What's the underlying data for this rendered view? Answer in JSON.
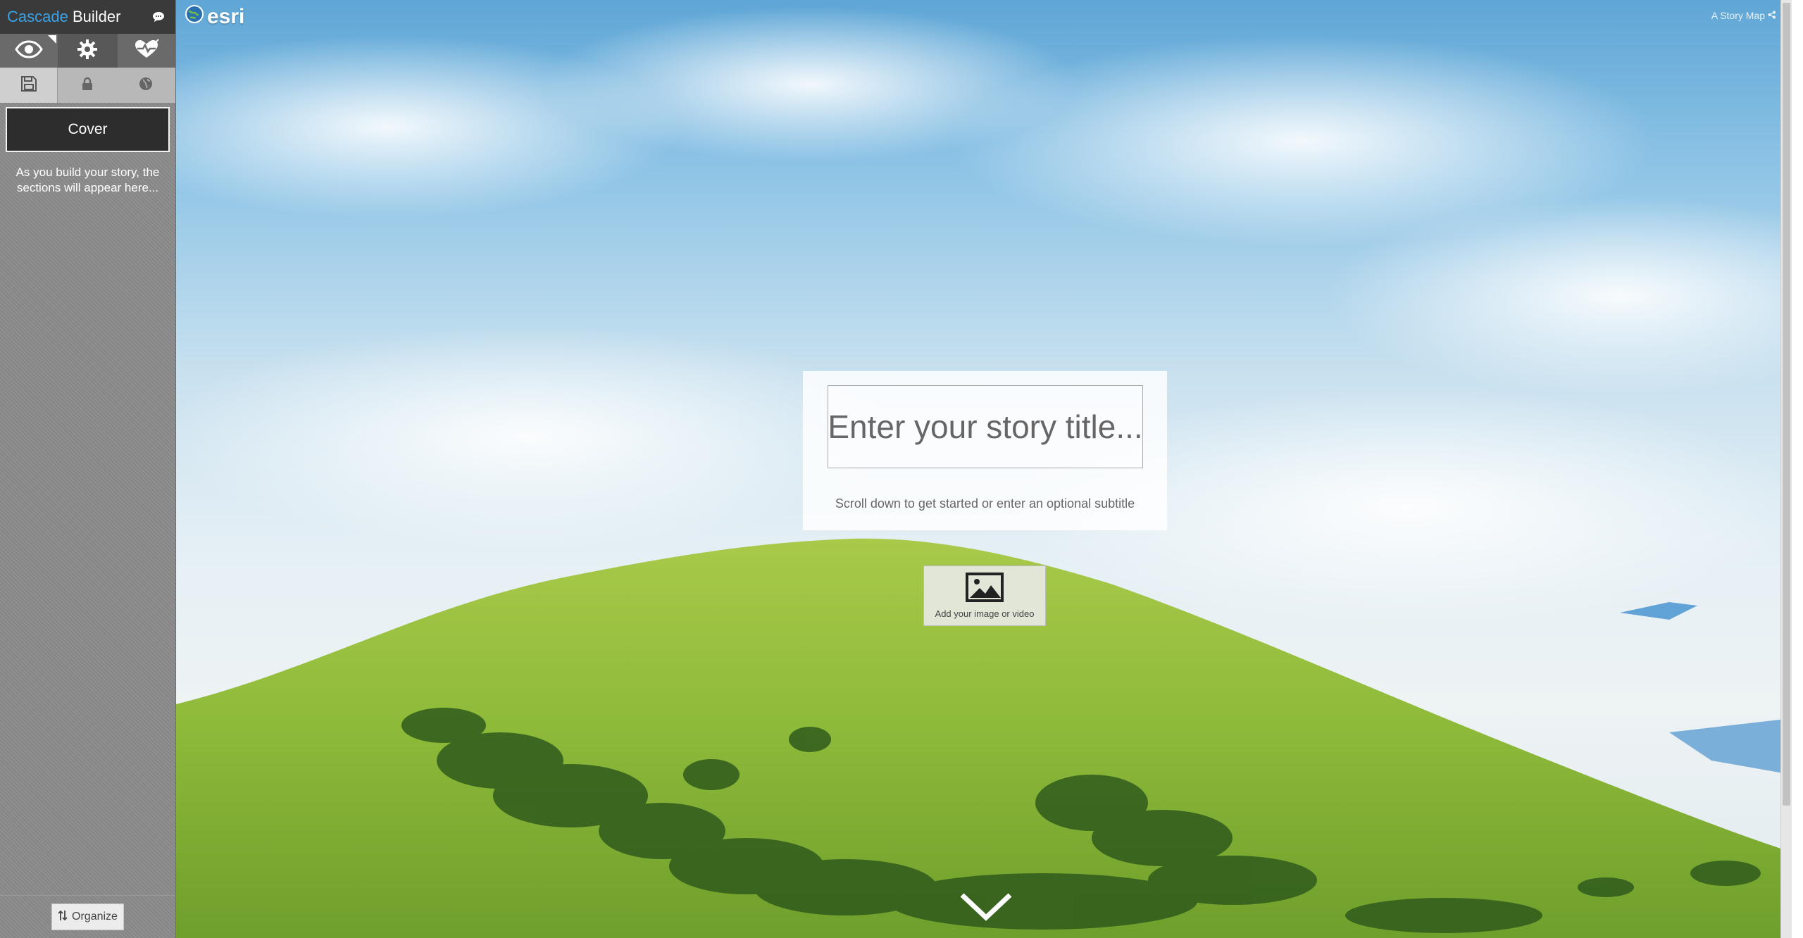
{
  "builder": {
    "brand_accent": "Cascade",
    "brand_rest": " Builder",
    "accent_color": "#3aa3e8",
    "icons": {
      "chat": "chat-icon",
      "view": "eye-icon",
      "settings": "gear-icon",
      "health": "heart-check-icon",
      "save": "save-icon",
      "lock": "lock-icon",
      "share": "globe-icon",
      "organize": "sort-arrows-icon"
    }
  },
  "sidebar": {
    "cover_label": "Cover",
    "hint": "As you build your story, the sections will appear here...",
    "organize_label": "Organize"
  },
  "stage": {
    "logo_text": "esri",
    "storymap_label": "A Story Map",
    "title_placeholder": "Enter your story title...",
    "subtitle_placeholder": "Scroll down to get started or enter an optional subtitle",
    "media_button_label": "Add your image or video"
  }
}
